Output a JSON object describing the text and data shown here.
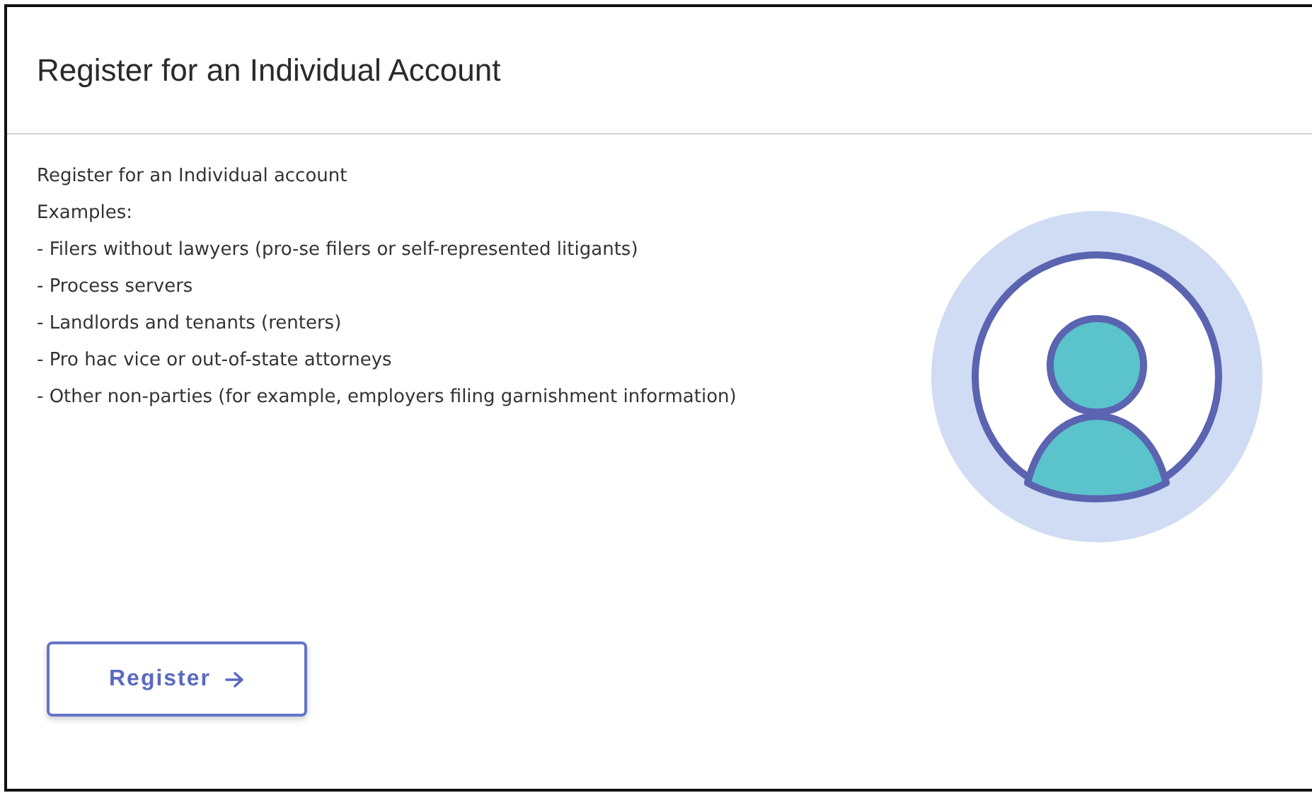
{
  "header": {
    "title": "Register for an Individual Account"
  },
  "body": {
    "intro": "Register for an Individual account",
    "examples_label": "Examples:",
    "examples": [
      "- Filers without lawyers (pro-se filers or self-represented litigants)",
      "- Process servers",
      "- Landlords and tenants (renters)",
      "- Pro hac vice or out-of-state attorneys",
      "- Other non-parties (for example, employers filing garnishment information)"
    ]
  },
  "button": {
    "label": "Register"
  }
}
